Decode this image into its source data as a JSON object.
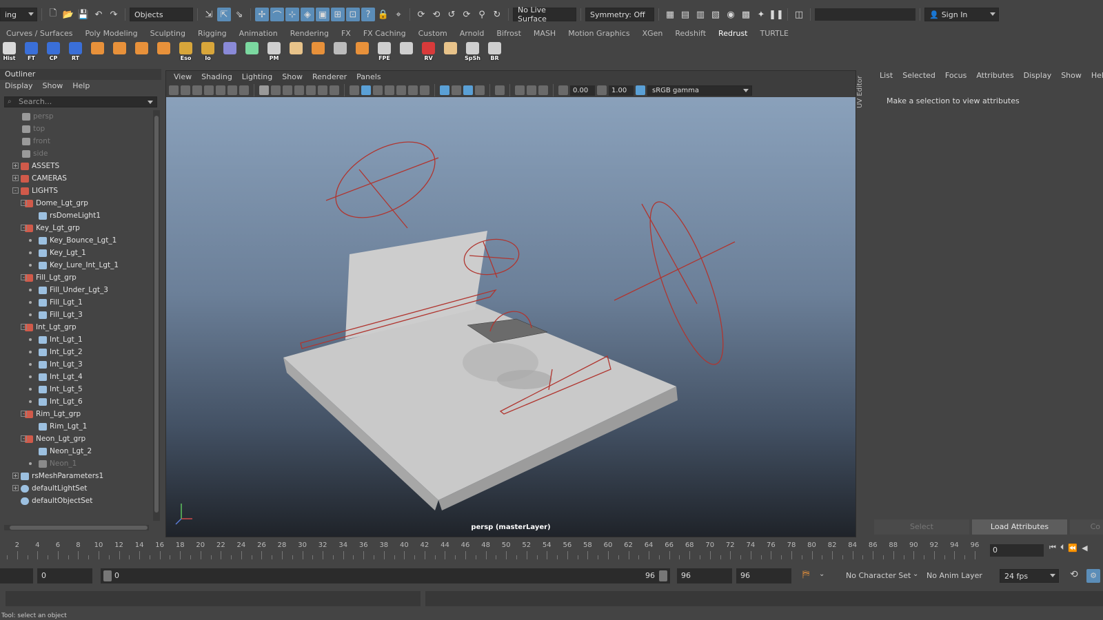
{
  "statusline": {
    "menu_set": "ing",
    "selection_mode": "Objects",
    "live_surface": "No Live Surface",
    "symmetry": "Symmetry: Off",
    "sign_in": "Sign In"
  },
  "shelf_tabs": [
    "Curves / Surfaces",
    "Poly Modeling",
    "Sculpting",
    "Rigging",
    "Animation",
    "Rendering",
    "FX",
    "FX Caching",
    "Custom",
    "Arnold",
    "Bifrost",
    "MASH",
    "Motion Graphics",
    "XGen",
    "Redshift",
    "Redrust",
    "TURTLE"
  ],
  "shelf_active": "Redrust",
  "shelf_icons": [
    {
      "label": "Hist",
      "icon": "history-icon",
      "color": "#d9d9d9"
    },
    {
      "label": "FT",
      "icon": "freeze-transform-icon",
      "color": "#3a6fd8"
    },
    {
      "label": "CP",
      "icon": "center-pivot-icon",
      "color": "#3a6fd8"
    },
    {
      "label": "RT",
      "icon": "reset-transform-icon",
      "color": "#3a6fd8"
    },
    {
      "label": "",
      "icon": "sphere-icon",
      "color": "#e8913a"
    },
    {
      "label": "",
      "icon": "cube-icon",
      "color": "#e8913a"
    },
    {
      "label": "",
      "icon": "cylinder-icon",
      "color": "#e8913a"
    },
    {
      "label": "",
      "icon": "diamond-icon",
      "color": "#e8913a"
    },
    {
      "label": "Eso",
      "icon": "folder-icon",
      "color": "#d8a63a"
    },
    {
      "label": "Io",
      "icon": "folder-open-icon",
      "color": "#d8a63a"
    },
    {
      "label": "",
      "icon": "wire-cube-icon",
      "color": "#8a8ad8"
    },
    {
      "label": "",
      "icon": "grid-select-icon",
      "color": "#7bd8a0"
    },
    {
      "label": "PM",
      "icon": "poly-model-icon",
      "color": "#cfcfcf"
    },
    {
      "label": "",
      "icon": "hand-icon",
      "color": "#e8c38a"
    },
    {
      "label": "",
      "icon": "bottle-icon",
      "color": "#e8913a"
    },
    {
      "label": "",
      "icon": "layout-grid-icon",
      "color": "#bcbcbc"
    },
    {
      "label": "",
      "icon": "stack-icon",
      "color": "#e8913a"
    },
    {
      "label": "FPE",
      "icon": "file-path-editor-icon",
      "color": "#cfcfcf"
    },
    {
      "label": "",
      "icon": "clapper-icon",
      "color": "#cfcfcf"
    },
    {
      "label": "RV",
      "icon": "render-view-icon",
      "color": "#d83a3a"
    },
    {
      "label": "",
      "icon": "pencil-icon",
      "color": "#e8c38a"
    },
    {
      "label": "SpSh",
      "icon": "spreadsheet-icon",
      "color": "#cfcfcf"
    },
    {
      "label": "BR",
      "icon": "batch-render-icon",
      "color": "#cfcfcf"
    }
  ],
  "outliner": {
    "title": "Outliner",
    "menu": [
      "Display",
      "Show",
      "Help"
    ],
    "search_placeholder": "Search...",
    "items": [
      {
        "label": "persp",
        "depth": 2,
        "type": "camera",
        "dim": true,
        "exp": ""
      },
      {
        "label": "top",
        "depth": 2,
        "type": "camera",
        "dim": true,
        "exp": ""
      },
      {
        "label": "front",
        "depth": 2,
        "type": "camera",
        "dim": true,
        "exp": ""
      },
      {
        "label": "side",
        "depth": 2,
        "type": "camera",
        "dim": true,
        "exp": ""
      },
      {
        "label": "ASSETS",
        "depth": 1,
        "type": "group",
        "dim": false,
        "exp": "+"
      },
      {
        "label": "CAMERAS",
        "depth": 1,
        "type": "group",
        "dim": false,
        "exp": "+"
      },
      {
        "label": "LIGHTS",
        "depth": 1,
        "type": "group",
        "dim": false,
        "exp": "-"
      },
      {
        "label": "Dome_Lgt_grp",
        "depth": 2,
        "type": "group",
        "dim": false,
        "exp": "-"
      },
      {
        "label": "rsDomeLight1",
        "depth": 3,
        "type": "light",
        "dim": false,
        "exp": ""
      },
      {
        "label": "Key_Lgt_grp",
        "depth": 2,
        "type": "group",
        "dim": false,
        "exp": "-"
      },
      {
        "label": "Key_Bounce_Lgt_1",
        "depth": 3,
        "type": "light",
        "dim": false,
        "exp": "o"
      },
      {
        "label": "Key_Lgt_1",
        "depth": 3,
        "type": "light",
        "dim": false,
        "exp": "o"
      },
      {
        "label": "Key_Lure_Int_Lgt_1",
        "depth": 3,
        "type": "light",
        "dim": false,
        "exp": "o"
      },
      {
        "label": "Fill_Lgt_grp",
        "depth": 2,
        "type": "group",
        "dim": false,
        "exp": "-"
      },
      {
        "label": "Fill_Under_Lgt_3",
        "depth": 3,
        "type": "light",
        "dim": false,
        "exp": "o"
      },
      {
        "label": "Fill_Lgt_1",
        "depth": 3,
        "type": "light",
        "dim": false,
        "exp": "o"
      },
      {
        "label": "Fill_Lgt_3",
        "depth": 3,
        "type": "light",
        "dim": false,
        "exp": "o"
      },
      {
        "label": "Int_Lgt_grp",
        "depth": 2,
        "type": "group",
        "dim": false,
        "exp": "-"
      },
      {
        "label": "Int_Lgt_1",
        "depth": 3,
        "type": "light",
        "dim": false,
        "exp": "o"
      },
      {
        "label": "Int_Lgt_2",
        "depth": 3,
        "type": "light",
        "dim": false,
        "exp": "o"
      },
      {
        "label": "Int_Lgt_3",
        "depth": 3,
        "type": "light",
        "dim": false,
        "exp": "o"
      },
      {
        "label": "Int_Lgt_4",
        "depth": 3,
        "type": "light",
        "dim": false,
        "exp": "o"
      },
      {
        "label": "Int_Lgt_5",
        "depth": 3,
        "type": "light",
        "dim": false,
        "exp": "o"
      },
      {
        "label": "Int_Lgt_6",
        "depth": 3,
        "type": "light",
        "dim": false,
        "exp": "o"
      },
      {
        "label": "Rim_Lgt_grp",
        "depth": 2,
        "type": "group",
        "dim": false,
        "exp": "-"
      },
      {
        "label": "Rim_Lgt_1",
        "depth": 3,
        "type": "light",
        "dim": false,
        "exp": ""
      },
      {
        "label": "Neon_Lgt_grp",
        "depth": 2,
        "type": "group",
        "dim": false,
        "exp": "-"
      },
      {
        "label": "Neon_Lgt_2",
        "depth": 3,
        "type": "light",
        "dim": false,
        "exp": ""
      },
      {
        "label": "Neon_1",
        "depth": 3,
        "type": "mesh",
        "dim": true,
        "exp": "o"
      },
      {
        "label": "rsMeshParameters1",
        "depth": 1,
        "type": "params",
        "dim": false,
        "exp": "+"
      },
      {
        "label": "defaultLightSet",
        "depth": 1,
        "type": "set",
        "dim": false,
        "exp": "+"
      },
      {
        "label": "defaultObjectSet",
        "depth": 1,
        "type": "set",
        "dim": false,
        "exp": ""
      }
    ]
  },
  "viewport": {
    "menu": [
      "View",
      "Shading",
      "Lighting",
      "Show",
      "Renderer",
      "Panels"
    ],
    "exposure": "0.00",
    "gamma": "1.00",
    "color_space": "sRGB gamma",
    "camera_label": "persp (masterLayer)"
  },
  "uv_editor_tab": "UV Editor",
  "attribute_editor": {
    "menu": [
      "List",
      "Selected",
      "Focus",
      "Attributes",
      "Display",
      "Show",
      "Help"
    ],
    "message": "Make a selection to view attributes",
    "select_button": "Select",
    "load_button": "Load Attributes",
    "copy_button": "Co"
  },
  "time_slider": {
    "labels": [
      "2",
      "4",
      "6",
      "8",
      "10",
      "12",
      "14",
      "16",
      "18",
      "20",
      "22",
      "24",
      "26",
      "28",
      "30",
      "32",
      "34",
      "36",
      "38",
      "40",
      "42",
      "44",
      "46",
      "48",
      "50",
      "52",
      "54",
      "56",
      "58",
      "60",
      "62",
      "64",
      "66",
      "68",
      "70",
      "72",
      "74",
      "76",
      "78",
      "80",
      "82",
      "84",
      "86",
      "88",
      "90",
      "92",
      "94",
      "96"
    ],
    "current_frame": "0"
  },
  "range_slider": {
    "scene_start": "",
    "playback_start": "0",
    "range_start": "0",
    "range_end": "96",
    "playback_end": "96",
    "scene_end": "96",
    "character_set": "No Character Set",
    "anim_layer": "No Anim Layer",
    "fps": "24 fps"
  },
  "help_line": "Tool: select an object",
  "colors": {
    "accent_blue": "#5b8db8",
    "light_rig_red": "#b0352f"
  }
}
